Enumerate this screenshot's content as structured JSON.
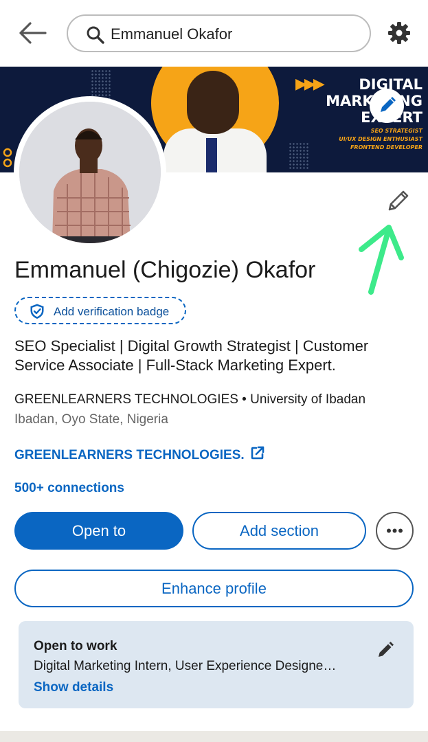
{
  "search": {
    "query": "Emmanuel Okafor"
  },
  "icons": {
    "back": "arrow-left-icon",
    "search": "search-icon",
    "settings": "gear-icon",
    "edit": "pencil-icon",
    "shield": "shield-check-icon",
    "external": "external-link-icon",
    "more": "ellipsis-icon"
  },
  "banner": {
    "title_line1": "DIGITAL",
    "title_line2": "MARKETING",
    "title_line3": "EXPERT",
    "tag1": "SEO STRATEGIST",
    "tag2": "UI/UX DESIGN ENTHUSIAST",
    "tag3": "FRONTEND DEVELOPER",
    "arrows": "▶▶▶"
  },
  "profile": {
    "name": "Emmanuel (Chigozie) Okafor",
    "verify_label": "Add verification badge",
    "headline": "SEO Specialist | Digital Growth Strategist | Customer Service Associate | Full-Stack Marketing Expert.",
    "company_line": "GREENLEARNERS TECHNOLOGIES • University of Ibadan",
    "location": "Ibadan, Oyo State, Nigeria",
    "company_link": "GREENLEARNERS TECHNOLOGIES.",
    "connections": "500+ connections"
  },
  "actions": {
    "open_to": "Open to",
    "add_section": "Add section",
    "enhance": "Enhance profile"
  },
  "open_to_work": {
    "title": "Open to work",
    "roles": "Digital Marketing Intern, User Experience Designe…",
    "show_details": "Show details"
  },
  "colors": {
    "brand_blue": "#0a66c2",
    "banner_navy": "#0d1a3c",
    "banner_orange": "#f6a417",
    "annotation_green": "#3dea8a",
    "card_bg": "#dde7f1"
  }
}
